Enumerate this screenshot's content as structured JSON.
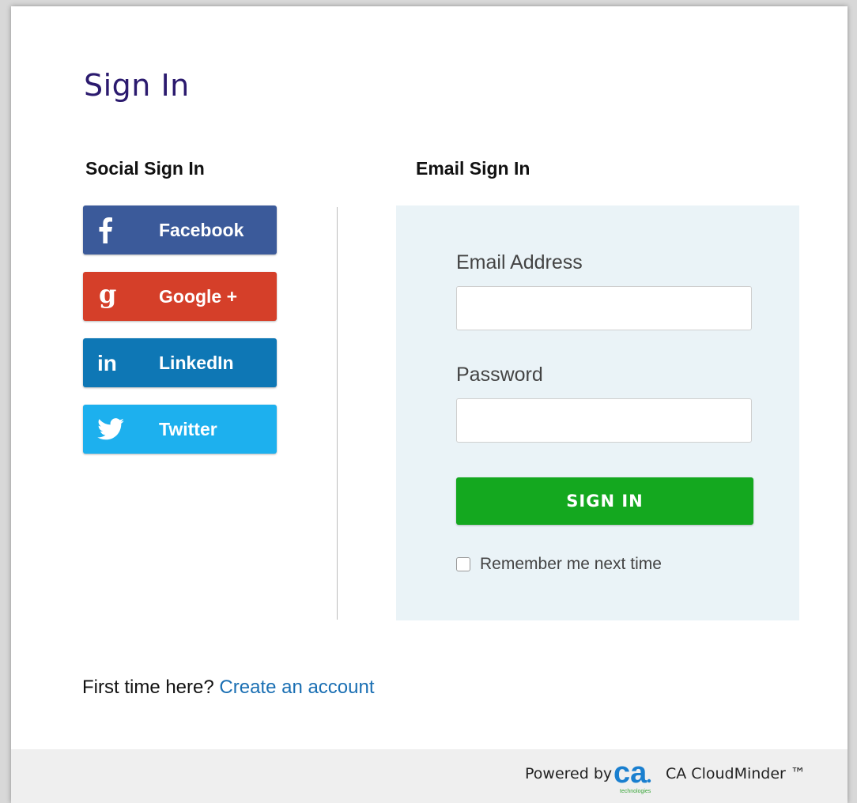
{
  "header": {
    "title": "Sign In"
  },
  "social": {
    "heading": "Social Sign In",
    "buttons": [
      {
        "label": "Facebook",
        "icon": "facebook-icon",
        "color": "#3b5a9a"
      },
      {
        "label": "Google +",
        "icon": "google-plus-icon",
        "color": "#d53f29"
      },
      {
        "label": "LinkedIn",
        "icon": "linkedin-icon",
        "color": "#0e77b5"
      },
      {
        "label": "Twitter",
        "icon": "twitter-icon",
        "color": "#1db0ee"
      }
    ]
  },
  "email": {
    "heading": "Email Sign In",
    "email_label": "Email Address",
    "email_value": "",
    "password_label": "Password",
    "password_value": "",
    "submit_label": "SIGN IN",
    "remember_label": "Remember me next time",
    "remember_checked": false
  },
  "signup": {
    "prompt": "First time here?",
    "link_label": "Create an account"
  },
  "footer": {
    "powered_by": "Powered by",
    "logo_text": "ca",
    "logo_subtext": "technologies",
    "product": "CA CloudMinder ™"
  },
  "colors": {
    "title": "#2b1a6e",
    "signin_button": "#14a81f",
    "link": "#1a6fb3",
    "email_panel_bg": "#eaf3f7"
  }
}
